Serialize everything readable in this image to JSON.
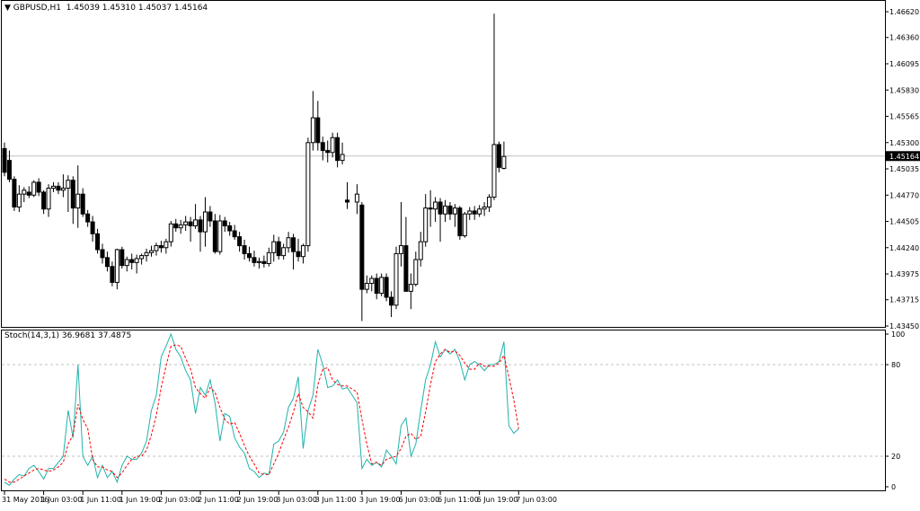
{
  "main_panel": {
    "symbol_title": "GBPUSD,H1",
    "ohlc_values": "1.45039 1.45310 1.45037 1.45164",
    "current_price_label": "1.45164"
  },
  "indicator_panel": {
    "title": "Stoch(14,3,1) 36.9681 37.4875"
  },
  "chart_data": [
    {
      "type": "candlestick",
      "title": "GBPUSD,H1",
      "ylim": [
        1.4345,
        1.4672
      ],
      "y_ticks": [
        "1.46620",
        "1.46360",
        "1.46095",
        "1.45830",
        "1.45565",
        "1.45300",
        "1.45035",
        "1.44770",
        "1.44505",
        "1.44240",
        "1.43975",
        "1.43715",
        "1.43450"
      ],
      "current_price": 1.45164,
      "grid": false,
      "candles": [
        [
          1.4524,
          1.453,
          1.4496,
          1.45
        ],
        [
          1.4512,
          1.4522,
          1.449,
          1.4493
        ],
        [
          1.4493,
          1.4496,
          1.4461,
          1.4465
        ],
        [
          1.4465,
          1.4487,
          1.446,
          1.4478
        ],
        [
          1.4478,
          1.4485,
          1.447,
          1.4482
        ],
        [
          1.448,
          1.4486,
          1.4474,
          1.4477
        ],
        [
          1.4477,
          1.4492,
          1.4475,
          1.449
        ],
        [
          1.449,
          1.4494,
          1.4476,
          1.448
        ],
        [
          1.448,
          1.4482,
          1.4458,
          1.4463
        ],
        [
          1.4463,
          1.4488,
          1.4455,
          1.4484
        ],
        [
          1.4484,
          1.449,
          1.448,
          1.4486
        ],
        [
          1.4486,
          1.449,
          1.4478,
          1.4482
        ],
        [
          1.4482,
          1.4498,
          1.4475,
          1.4484
        ],
        [
          1.4484,
          1.4497,
          1.446,
          1.4492
        ],
        [
          1.4492,
          1.4496,
          1.4448,
          1.4464
        ],
        [
          1.4464,
          1.4507,
          1.4444,
          1.4478
        ],
        [
          1.4478,
          1.4484,
          1.4455,
          1.4458
        ],
        [
          1.4458,
          1.4462,
          1.4445,
          1.445
        ],
        [
          1.445,
          1.4456,
          1.443,
          1.4438
        ],
        [
          1.4438,
          1.4443,
          1.4418,
          1.4422
        ],
        [
          1.4422,
          1.4428,
          1.4408,
          1.4414
        ],
        [
          1.4414,
          1.442,
          1.44,
          1.4405
        ],
        [
          1.4405,
          1.441,
          1.4385,
          1.4389
        ],
        [
          1.4389,
          1.4423,
          1.4382,
          1.4422
        ],
        [
          1.4422,
          1.4425,
          1.4403,
          1.4406
        ],
        [
          1.4406,
          1.4415,
          1.44,
          1.4412
        ],
        [
          1.4412,
          1.4418,
          1.4402,
          1.4409
        ],
        [
          1.4409,
          1.4417,
          1.4398,
          1.4413
        ],
        [
          1.4413,
          1.4418,
          1.4407,
          1.4416
        ],
        [
          1.4416,
          1.4423,
          1.441,
          1.4419
        ],
        [
          1.4419,
          1.4426,
          1.4415,
          1.4421
        ],
        [
          1.4421,
          1.4429,
          1.4416,
          1.4426
        ],
        [
          1.4426,
          1.4431,
          1.4419,
          1.4424
        ],
        [
          1.4424,
          1.4433,
          1.4418,
          1.443
        ],
        [
          1.443,
          1.4451,
          1.4425,
          1.4448
        ],
        [
          1.4448,
          1.4453,
          1.444,
          1.4444
        ],
        [
          1.4444,
          1.4452,
          1.4438,
          1.4447
        ],
        [
          1.4447,
          1.4456,
          1.4441,
          1.445
        ],
        [
          1.445,
          1.4455,
          1.443,
          1.4446
        ],
        [
          1.4446,
          1.4468,
          1.4443,
          1.4452
        ],
        [
          1.4452,
          1.4456,
          1.442,
          1.444
        ],
        [
          1.444,
          1.4475,
          1.4425,
          1.446
        ],
        [
          1.446,
          1.4466,
          1.4445,
          1.4451
        ],
        [
          1.4451,
          1.4458,
          1.4418,
          1.442
        ],
        [
          1.442,
          1.4457,
          1.4417,
          1.4451
        ],
        [
          1.4451,
          1.4455,
          1.444,
          1.4446
        ],
        [
          1.4446,
          1.445,
          1.4436,
          1.4441
        ],
        [
          1.4441,
          1.4447,
          1.4432,
          1.4435
        ],
        [
          1.4435,
          1.444,
          1.442,
          1.4426
        ],
        [
          1.4426,
          1.4432,
          1.4412,
          1.4418
        ],
        [
          1.4418,
          1.4425,
          1.441,
          1.4414
        ],
        [
          1.4414,
          1.4421,
          1.4405,
          1.4409
        ],
        [
          1.4409,
          1.4414,
          1.4403,
          1.441
        ],
        [
          1.441,
          1.4416,
          1.4404,
          1.4408
        ],
        [
          1.4408,
          1.4424,
          1.4405,
          1.4419
        ],
        [
          1.4419,
          1.4437,
          1.441,
          1.443
        ],
        [
          1.443,
          1.4435,
          1.4412,
          1.4416
        ],
        [
          1.4416,
          1.4428,
          1.4412,
          1.4424
        ],
        [
          1.4424,
          1.444,
          1.4419,
          1.4434
        ],
        [
          1.4434,
          1.4438,
          1.4402,
          1.442
        ],
        [
          1.442,
          1.4433,
          1.441,
          1.4415
        ],
        [
          1.4415,
          1.4428,
          1.4408,
          1.4426
        ],
        [
          1.4426,
          1.4535,
          1.442,
          1.453
        ],
        [
          1.453,
          1.4582,
          1.4522,
          1.4555
        ],
        [
          1.4555,
          1.4572,
          1.4522,
          1.453
        ],
        [
          1.453,
          1.4536,
          1.4512,
          1.4522
        ],
        [
          1.4522,
          1.4532,
          1.451,
          1.452
        ],
        [
          1.452,
          1.454,
          1.4515,
          1.4535
        ],
        [
          1.4535,
          1.454,
          1.4505,
          1.4512
        ],
        [
          1.4512,
          1.453,
          1.4508,
          1.4518
        ],
        [
          1.4472,
          1.449,
          1.4463,
          1.447
        ],
        [
          1.447,
          1.4488,
          1.4458,
          1.4478
        ],
        [
          1.4467,
          1.447,
          1.435,
          1.4382
        ],
        [
          1.4382,
          1.4396,
          1.4378,
          1.4388
        ],
        [
          1.4388,
          1.4396,
          1.438,
          1.4393
        ],
        [
          1.4393,
          1.4398,
          1.4372,
          1.4378
        ],
        [
          1.4378,
          1.4398,
          1.4375,
          1.4394
        ],
        [
          1.4394,
          1.4398,
          1.437,
          1.4374
        ],
        [
          1.4374,
          1.438,
          1.4354,
          1.4366
        ],
        [
          1.4366,
          1.4425,
          1.4362,
          1.4418
        ],
        [
          1.4418,
          1.447,
          1.4405,
          1.4426
        ],
        [
          1.4426,
          1.4455,
          1.439,
          1.438
        ],
        [
          1.438,
          1.4398,
          1.4362,
          1.4387
        ],
        [
          1.4387,
          1.442,
          1.4385,
          1.4412
        ],
        [
          1.4412,
          1.444,
          1.4405,
          1.443
        ],
        [
          1.443,
          1.4478,
          1.4425,
          1.4464
        ],
        [
          1.4464,
          1.4482,
          1.4445,
          1.4463
        ],
        [
          1.4463,
          1.4475,
          1.445,
          1.447
        ],
        [
          1.447,
          1.4474,
          1.443,
          1.4458
        ],
        [
          1.4458,
          1.4472,
          1.445,
          1.4466
        ],
        [
          1.4466,
          1.447,
          1.4452,
          1.4458
        ],
        [
          1.4458,
          1.4468,
          1.4445,
          1.4464
        ],
        [
          1.4464,
          1.4466,
          1.4432,
          1.4436
        ],
        [
          1.4436,
          1.446,
          1.4434,
          1.4458
        ],
        [
          1.4458,
          1.4465,
          1.4452,
          1.4461
        ],
        [
          1.4461,
          1.4466,
          1.4452,
          1.4458
        ],
        [
          1.4458,
          1.4467,
          1.4455,
          1.4463
        ],
        [
          1.4463,
          1.447,
          1.4456,
          1.4465
        ],
        [
          1.4465,
          1.4478,
          1.446,
          1.4475
        ],
        [
          1.4475,
          1.466,
          1.4472,
          1.4528
        ],
        [
          1.4528,
          1.4531,
          1.45,
          1.4505
        ],
        [
          1.4504,
          1.4531,
          1.4503,
          1.4516
        ]
      ]
    },
    {
      "type": "line",
      "title": "Stoch(14,3,1)",
      "ylim": [
        0,
        100
      ],
      "y_ticks": [
        "100",
        "80",
        "20",
        "0"
      ],
      "levels": [
        80,
        20
      ],
      "grid": false,
      "x_tick_labels": [
        "31 May 2016",
        "1 Jun 03:00",
        "1 Jun 11:00",
        "1 Jun 19:00",
        "2 Jun 03:00",
        "2 Jun 11:00",
        "2 Jun 19:00",
        "3 Jun 03:00",
        "3 Jun 11:00",
        "3 Jun 19:00",
        "6 Jun 03:00",
        "6 Jun 11:00",
        "6 Jun 19:00",
        "7 Jun 03:00"
      ],
      "x_tick_candle_index": [
        0,
        8,
        16,
        24,
        32,
        40,
        48,
        56,
        64,
        72,
        80,
        88,
        96,
        104
      ],
      "series": [
        {
          "name": "",
          "color": "#20b2aa",
          "values": [
            3,
            1,
            5,
            8,
            7,
            12,
            14,
            10,
            5,
            12,
            12,
            16,
            20,
            50,
            32,
            80,
            20,
            14,
            20,
            6,
            14,
            6,
            10,
            3,
            14,
            20,
            18,
            18,
            22,
            30,
            50,
            60,
            85,
            92,
            100,
            90,
            85,
            76,
            70,
            48,
            65,
            60,
            70,
            55,
            30,
            48,
            46,
            32,
            26,
            22,
            12,
            10,
            6,
            9,
            8,
            28,
            30,
            36,
            52,
            58,
            72,
            25,
            50,
            60,
            90,
            80,
            65,
            66,
            70,
            64,
            65,
            55,
            12,
            18,
            14,
            16,
            13,
            24,
            20,
            15,
            40,
            45,
            20,
            28,
            50,
            70,
            80,
            95,
            85,
            90,
            87,
            90,
            82,
            70,
            80,
            82,
            80,
            76,
            80,
            80,
            82,
            95,
            40,
            35,
            38
          ]
        },
        {
          "name": "",
          "color": "#ff0000",
          "values": [
            5,
            3,
            3,
            5,
            7,
            9,
            11,
            12,
            11,
            10,
            11,
            13,
            16,
            28,
            34,
            54,
            44,
            38,
            18,
            13,
            13,
            11,
            10,
            6,
            9,
            14,
            18,
            20,
            20,
            24,
            34,
            47,
            65,
            79,
            92,
            93,
            92,
            84,
            77,
            65,
            61,
            58,
            65,
            62,
            52,
            44,
            41,
            42,
            35,
            27,
            20,
            15,
            9,
            8,
            8,
            15,
            22,
            31,
            39,
            49,
            61,
            52,
            49,
            45,
            67,
            77,
            78,
            70,
            67,
            66,
            66,
            62,
            44,
            28,
            15,
            16,
            14,
            18,
            19,
            20,
            25,
            33,
            35,
            31,
            33,
            49,
            67,
            82,
            87,
            90,
            88,
            89,
            86,
            81,
            77,
            77,
            81,
            79,
            79,
            79,
            81,
            86,
            72,
            57,
            38
          ]
        }
      ]
    }
  ]
}
